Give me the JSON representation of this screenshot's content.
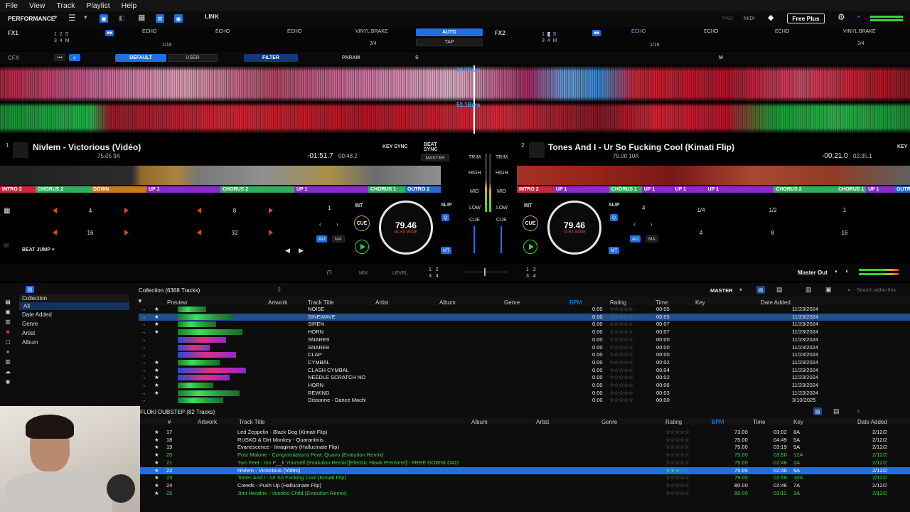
{
  "menu": [
    "File",
    "View",
    "Track",
    "Playlist",
    "Help"
  ],
  "toolbar": {
    "mode": "PERFORMANCE",
    "link": "LINK",
    "pad": "PAD",
    "midi": "MIDI",
    "free_plus": "Free Plus"
  },
  "fx1": {
    "label": "FX1",
    "effects": [
      "ECHO",
      "ECHO",
      "ECHO",
      "VINYL BRAKE"
    ],
    "beat": "1/16",
    "auto": "AUTO",
    "tap": "TAP",
    "beats": "3/4"
  },
  "fx2": {
    "label": "FX2",
    "effects": [
      "ECHO",
      "ECHO",
      "ECHO",
      "VINYL BRAKE"
    ],
    "beat": "1/16",
    "beats": "3/4"
  },
  "cfx": {
    "label": "CFX",
    "default": "DEFAULT",
    "user": "USER",
    "filter": "FILTER",
    "param": "PARAM",
    "s": "S",
    "m": "M"
  },
  "bars": {
    "top": "16.1Bars",
    "bottom": "52.1Bars"
  },
  "deck1": {
    "num": "1",
    "title": "Nivlem - Victorious (Vidéo)",
    "bpm": "75.05 9A",
    "remain": "-01:51.7",
    "elapsed": "00:48.2",
    "key_sync": "KEY SYNC",
    "beat_sync": "BEAT SYNC",
    "master": "MASTER",
    "jog_bpm": "79.46",
    "jog_sub": "81.69 WIDE",
    "int": "INT",
    "slip": "SLIP",
    "cue": "CUE",
    "q": "Q",
    "au": "AU",
    "ma": "MA",
    "mt": "MT",
    "loop": "1",
    "beat_jump": "BEAT JUMP"
  },
  "deck1_cues": [
    {
      "label": "INTRO 2",
      "color": "#c8283c",
      "w": 50
    },
    {
      "label": "CHORUS 2",
      "color": "#2fb05a",
      "w": 78
    },
    {
      "label": "DOWN",
      "color": "#c87a1a",
      "w": 78
    },
    {
      "label": "UP 1",
      "color": "#8a2ad0",
      "w": 104
    },
    {
      "label": "CHORUS 2",
      "color": "#2fb05a",
      "w": 104
    },
    {
      "label": "UP 1",
      "color": "#8a2ad0",
      "w": 104
    },
    {
      "label": "CHORUS 1",
      "color": "#2fb05a",
      "w": 52
    },
    {
      "label": "OUTRO 2",
      "color": "#2a6ad0",
      "w": 50
    }
  ],
  "deck1_pads": [
    "4",
    "8",
    "16",
    "32"
  ],
  "deck2": {
    "num": "2",
    "title": "Tones And I - Ur So Fucking Cool (Kimati Flip)",
    "bpm": "79.00 10A",
    "remain": "-00:21.0",
    "elapsed": "02:35.1",
    "key": "KEY",
    "jog_bpm": "79.46",
    "jog_sub": "72.61 WIDE",
    "int": "INT",
    "slip": "SLIP",
    "cue": "CUE",
    "q": "Q",
    "au": "AU",
    "ma": "MA",
    "mt": "MT",
    "loop": "4"
  },
  "deck2_cues": [
    {
      "label": "INTRO 2",
      "color": "#c8283c",
      "w": 52
    },
    {
      "label": "UP 1",
      "color": "#8a2ad0",
      "w": 78
    },
    {
      "label": "CHORUS 1",
      "color": "#2fb05a",
      "w": 46
    },
    {
      "label": "UP 1",
      "color": "#8a2ad0",
      "w": 44
    },
    {
      "label": "UP 1",
      "color": "#8a2ad0",
      "w": 46
    },
    {
      "label": "UP 1",
      "color": "#8a2ad0",
      "w": 96
    },
    {
      "label": "CHORUS 2",
      "color": "#2fb05a",
      "w": 88
    },
    {
      "label": "CHORUS 1",
      "color": "#2fb05a",
      "w": 42
    },
    {
      "label": "UP 1",
      "color": "#8a2ad0",
      "w": 40
    },
    {
      "label": "OUTR",
      "color": "#2a6ad0",
      "w": 22
    }
  ],
  "deck2_pads": [
    "1/4",
    "1/2",
    "1",
    "4",
    "8",
    "16"
  ],
  "mixer": {
    "trim": "TRIM",
    "high": "HIGH",
    "mid": "MID",
    "low": "LOW",
    "cue": "CUE",
    "mix": "MIX",
    "level": "LEVEL",
    "master_out": "Master Out"
  },
  "collection": {
    "title": "Collection (6368 Tracks)",
    "sidebar": [
      "Collection",
      "All",
      "Date Added",
      "Genre",
      "Artist",
      "Album"
    ],
    "columns": [
      "Preview",
      "Artwork",
      "Track Title",
      "Artist",
      "Album",
      "Genre",
      "BPM",
      "Rating",
      "Time",
      "Key",
      "Date Added"
    ],
    "master": "MASTER",
    "search_placeholder": "Search within this",
    "rows": [
      {
        "title": "NOISE",
        "bpm": "0.00",
        "time": "00:05",
        "date": "11/23/2024",
        "star": true
      },
      {
        "title": "SINEWAVE",
        "bpm": "0.00",
        "time": "00:05",
        "date": "11/23/2024",
        "star": true
      },
      {
        "title": "SIREN",
        "bpm": "0.00",
        "time": "00:07",
        "date": "11/23/2024",
        "star": true
      },
      {
        "title": "HORN",
        "bpm": "0.00",
        "time": "00:07",
        "date": "11/23/2024",
        "star": true
      },
      {
        "title": "SNARE9",
        "bpm": "0.00",
        "time": "00:00",
        "date": "11/23/2024",
        "star": false
      },
      {
        "title": "SNARE8",
        "bpm": "0.00",
        "time": "00:00",
        "date": "11/23/2024",
        "star": false
      },
      {
        "title": "CLAP",
        "bpm": "0.00",
        "time": "00:00",
        "date": "11/23/2024",
        "star": false
      },
      {
        "title": "CYMBAL",
        "bpm": "0.00",
        "time": "00:02",
        "date": "11/23/2024",
        "star": true
      },
      {
        "title": "CLASH CYMBAL",
        "bpm": "0.00",
        "time": "00:04",
        "date": "11/23/2024",
        "star": true
      },
      {
        "title": "NEEDLE SCRATCH NO",
        "bpm": "0.00",
        "time": "00:02",
        "date": "11/23/2024",
        "star": true
      },
      {
        "title": "HORN",
        "bpm": "0.00",
        "time": "00:06",
        "date": "11/23/2024",
        "star": true
      },
      {
        "title": "REWIND",
        "bpm": "0.00",
        "time": "00:03",
        "date": "11/23/2024",
        "star": true
      },
      {
        "title": "Dissonne - Dance Machi",
        "bpm": "0.00",
        "time": "00:00",
        "date": "3/10/2025",
        "star": false
      }
    ]
  },
  "playlist": {
    "title": "FLOKI DUBSTEP (82 Tracks)",
    "columns": [
      "#",
      "Artwork",
      "Track Title",
      "Album",
      "Artist",
      "Genre",
      "Rating",
      "BPM",
      "Time",
      "Key",
      "Date Added"
    ],
    "rows": [
      {
        "n": "17",
        "title": "Led Zeppelin - Black Dog (Kimati Flip)",
        "bpm": "73.00",
        "time": "03:02",
        "key": "8A",
        "date": "2/12/2",
        "green": false
      },
      {
        "n": "18",
        "title": "RUSKO & Dirt Monkey - Quarantinis",
        "bpm": "75.00",
        "time": "04:49",
        "key": "5A",
        "date": "2/12/2",
        "green": false
      },
      {
        "n": "19",
        "title": "Evanescence - Imaginary (Hallucinate Flip)",
        "bpm": "75.00",
        "time": "03:19",
        "key": "9A",
        "date": "2/12/2",
        "green": false
      },
      {
        "n": "20",
        "title": "Post Malone - Congratulations Feat. Quavo (Evalution Remix)",
        "bpm": "75.00",
        "time": "03:50",
        "key": "12A",
        "date": "2/12/2",
        "green": true
      },
      {
        "n": "21",
        "title": "Two Feet - Go F__k Yourself (Evalution Remix)[Electric Hawk Premiere] - FREE DOWNLOAD",
        "bpm": "75.00",
        "time": "02:46",
        "key": "2A",
        "date": "2/12/2",
        "green": true
      },
      {
        "n": "22",
        "title": "Nivlem - Victorious (Vidéo)",
        "bpm": "75.05",
        "time": "02:40",
        "key": "9A",
        "date": "2/12/2",
        "green": false,
        "selected": true
      },
      {
        "n": "23",
        "title": "Tones And I - Ur So Fucking Cool (Kimati Flip)",
        "bpm": "79.00",
        "time": "02:56",
        "key": "10A",
        "date": "2/12/2",
        "green": true
      },
      {
        "n": "24",
        "title": "Creeds - Push Up (Hallucinate Flip)",
        "bpm": "80.00",
        "time": "02:46",
        "key": "7A",
        "date": "2/12/2",
        "green": false
      },
      {
        "n": "25",
        "title": "Jimi Hendrix - Voodoo Child (Evalution Remix)",
        "bpm": "80.00",
        "time": "03:11",
        "key": "3A",
        "date": "2/12/2",
        "green": true
      }
    ]
  }
}
